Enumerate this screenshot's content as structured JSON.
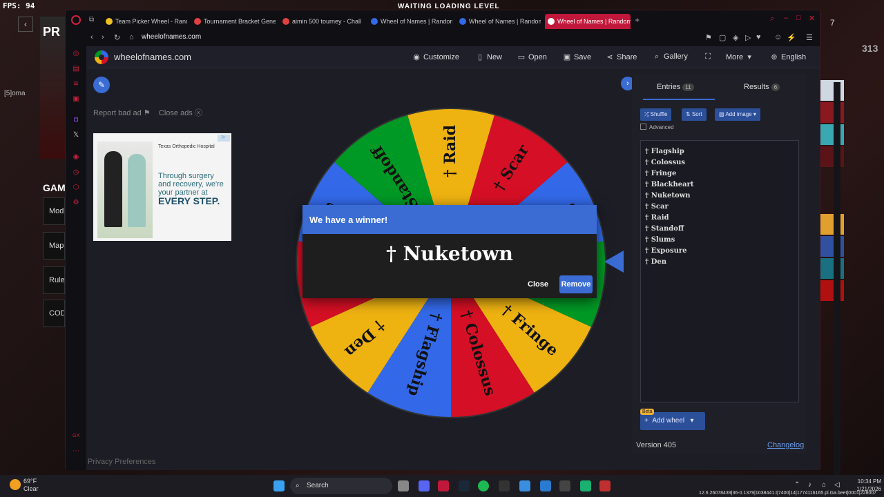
{
  "fps": {
    "label": "FPS:",
    "value": "94"
  },
  "game": {
    "title": "GAM",
    "banner": "PR",
    "user": "[5]oma",
    "buttons": [
      "Mod",
      "Map",
      "Rule",
      "COD"
    ],
    "loading": "WAITING LOADING LEVEL"
  },
  "right_strip": {
    "number": "313",
    "counter": "7"
  },
  "browser": {
    "tabs": [
      {
        "label": "Team Picker Wheel - Rand",
        "color": "#f0c020"
      },
      {
        "label": "Tournament Bracket Gene",
        "color": "#e04040"
      },
      {
        "label": "aimin 500 tourney - Chall",
        "color": "#e04040"
      },
      {
        "label": "Wheel of Names | Random",
        "color": "#3369e8"
      },
      {
        "label": "Wheel of Names | Random",
        "color": "#3369e8"
      },
      {
        "label": "Wheel of Names | Random",
        "color": "#3369e8"
      }
    ],
    "url": "wheelofnames.com"
  },
  "site": {
    "name": "wheelofnames.com",
    "nav": [
      {
        "icon": "palette-icon",
        "glyph": "◉",
        "label": "Customize"
      },
      {
        "icon": "new-file-icon",
        "glyph": "▯",
        "label": "New"
      },
      {
        "icon": "folder-open-icon",
        "glyph": "▭",
        "label": "Open"
      },
      {
        "icon": "save-icon",
        "glyph": "▣",
        "label": "Save"
      },
      {
        "icon": "share-icon",
        "glyph": "⋖",
        "label": "Share"
      },
      {
        "icon": "search-icon",
        "glyph": "⌕",
        "label": "Gallery"
      },
      {
        "icon": "fullscreen-icon",
        "glyph": "⛶",
        "label": ""
      },
      {
        "icon": "chevron-down-icon",
        "glyph": "▾",
        "label": "More"
      },
      {
        "icon": "globe-icon",
        "glyph": "⊕",
        "label": "English"
      }
    ],
    "report_ad": "Report bad ad",
    "close_ads": "Close ads",
    "privacy": "Privacy Preferences"
  },
  "ad": {
    "hospital": "Texas Orthopedic Hospital",
    "copy": "Through surgery and recovery, we're your partner at",
    "tagline": "EVERY STEP."
  },
  "wheel": {
    "segments": [
      {
        "label": "Raid",
        "color": "#eeb211"
      },
      {
        "label": "Scar",
        "color": "#d50f25"
      },
      {
        "label": "Nuketown",
        "color": "#3369e8"
      },
      {
        "label": "Blackheart",
        "color": "#009925"
      },
      {
        "label": "Fringe",
        "color": "#eeb211"
      },
      {
        "label": "Colossus",
        "color": "#d50f25"
      },
      {
        "label": "Flagship",
        "color": "#3369e8"
      },
      {
        "label": "Den",
        "color": "#eeb211"
      },
      {
        "label": "Exposure",
        "color": "#d50f25"
      },
      {
        "label": "Slums",
        "color": "#3369e8"
      },
      {
        "label": "Standoff",
        "color": "#009925"
      }
    ],
    "prefix": "†"
  },
  "dialog": {
    "title": "We have a winner!",
    "winner": "† Nuketown",
    "close_label": "Close",
    "remove_label": "Remove"
  },
  "panel": {
    "entries_label": "Entries",
    "entries_count": "11",
    "results_label": "Results",
    "results_count": "6",
    "shuffle_label": "Shuffle",
    "sort_label": "Sort",
    "add_image_label": "Add image",
    "advanced_label": "Advanced",
    "entries": [
      "† Flagship",
      "† Colossus",
      "† Fringe",
      "† Blackheart",
      "† Nuketown",
      "† Scar",
      "† Raid",
      "† Standoff",
      "† Slums",
      "† Exposure",
      "† Den"
    ],
    "beta_label": "Beta",
    "add_wheel_label": "Add wheel",
    "version": "Version 405",
    "changelog": "Changelog"
  },
  "taskbar": {
    "temp": "69°F",
    "condition": "Clear",
    "search": "Search",
    "time": "10:34 PM",
    "date": "1/21/2026",
    "overlay": "12.6 26078439|36-0.1379|1038441.t|7400|14|1774116165.pl.Ga.beet|0001|228007"
  },
  "colors": {
    "accent": "#3a6cd4",
    "brand_red": "#c0183a"
  }
}
